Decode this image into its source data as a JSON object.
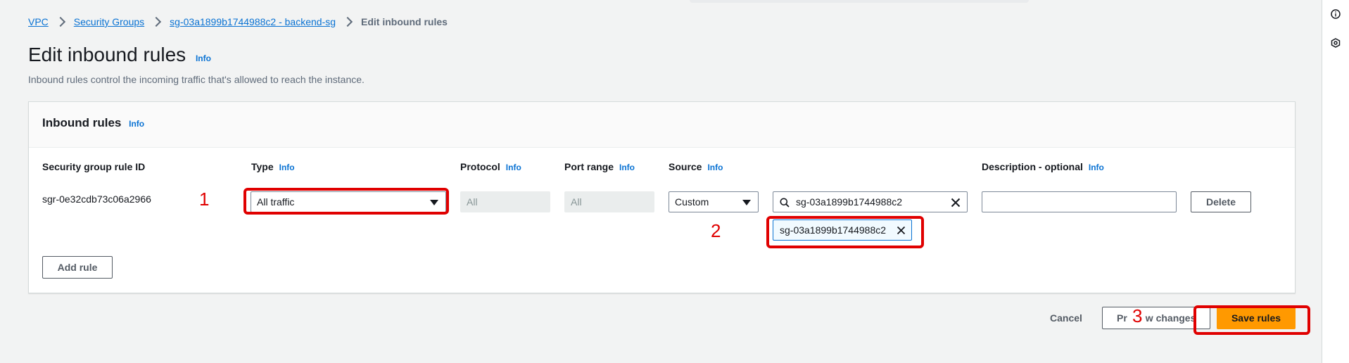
{
  "colors": {
    "accent": "#0972d3",
    "primary": "#ff9900",
    "annotation": "#e00000"
  },
  "breadcrumb": [
    "VPC",
    "Security Groups",
    "sg-03a1899b1744988c2 - backend-sg",
    "Edit inbound rules"
  ],
  "page": {
    "title": "Edit inbound rules",
    "info": "Info",
    "description": "Inbound rules control the incoming traffic that's allowed to reach the instance."
  },
  "panel": {
    "title": "Inbound rules",
    "info": "Info",
    "columns": {
      "rule_id": "Security group rule ID",
      "type": "Type",
      "protocol": "Protocol",
      "port_range": "Port range",
      "source": "Source",
      "description": "Description - optional",
      "info": "Info"
    },
    "row": {
      "rule_id": "sgr-0e32cdb73c06a2966",
      "type_value": "All traffic",
      "protocol_value": "All",
      "port_value": "All",
      "source_value": "Custom",
      "search_value": "sg-03a1899b1744988c2",
      "token_value": "sg-03a1899b1744988c2",
      "description_value": "",
      "delete_label": "Delete"
    },
    "add_rule_label": "Add rule"
  },
  "footer": {
    "cancel_label": "Cancel",
    "preview_label": "Pr",
    "preview_label_tail": "w changes",
    "save_label": "Save rules"
  },
  "annotations": {
    "one": "1",
    "two": "2",
    "three": "3"
  },
  "icons": {
    "rail_top": "info-icon",
    "rail_second": "settings-icon",
    "search": "search-icon",
    "clear": "close-icon"
  }
}
